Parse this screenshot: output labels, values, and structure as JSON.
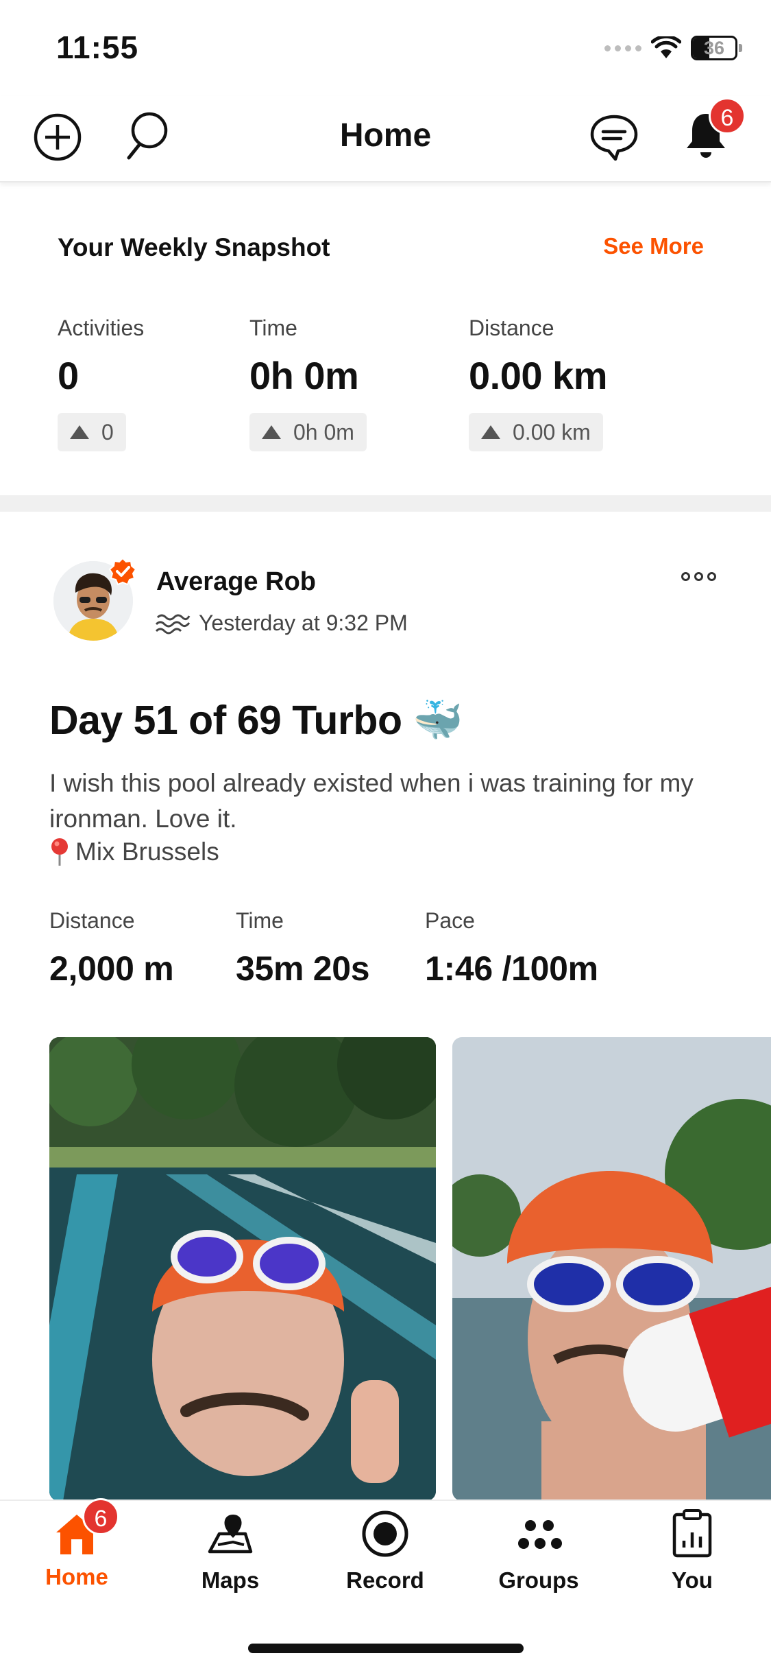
{
  "status_bar": {
    "time": "11:55",
    "battery": "36"
  },
  "header": {
    "title": "Home",
    "notifications_count": "6"
  },
  "snapshot": {
    "title": "Your Weekly Snapshot",
    "see_more": "See More",
    "stats": [
      {
        "label": "Activities",
        "value": "0",
        "delta": "0"
      },
      {
        "label": "Time",
        "value": "0h 0m",
        "delta": "0h 0m"
      },
      {
        "label": "Distance",
        "value": "0.00 km",
        "delta": "0.00 km"
      }
    ]
  },
  "post": {
    "author": "Average Rob",
    "timestamp": "Yesterday at 9:32 PM",
    "title": "Day 51 of 69 Turbo 🐳",
    "description": "I wish this pool already existed when i was training for my ironman. Love it.",
    "location": "Mix Brussels",
    "stats": [
      {
        "label": "Distance",
        "value": "2,000 m"
      },
      {
        "label": "Time",
        "value": "35m 20s"
      },
      {
        "label": "Pace",
        "value": "1:46 /100m"
      }
    ]
  },
  "nav": {
    "home_badge": "6",
    "items": [
      {
        "label": "Home",
        "icon": "home-icon",
        "active": true
      },
      {
        "label": "Maps",
        "icon": "map-icon"
      },
      {
        "label": "Record",
        "icon": "record-icon"
      },
      {
        "label": "Groups",
        "icon": "groups-icon"
      },
      {
        "label": "You",
        "icon": "profile-icon"
      }
    ]
  },
  "colors": {
    "accent": "#fc5200",
    "badge": "#e3342f"
  }
}
